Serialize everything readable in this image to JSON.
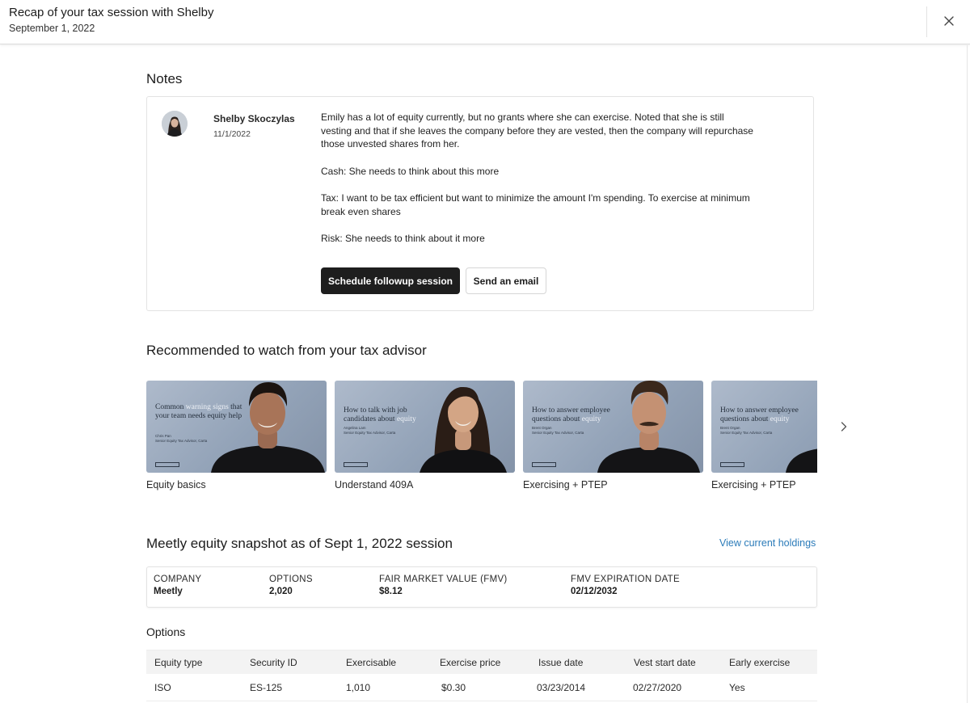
{
  "header": {
    "title": "Recap of your tax session with Shelby",
    "date": "September 1, 2022"
  },
  "notes": {
    "heading": "Notes",
    "author": "Shelby Skoczylas",
    "date": "11/1/2022",
    "paragraphs": [
      "Emily has a lot of equity currently, but no grants where she can exercise. Noted that she is still vesting and that if she leaves the company before they are vested, then the company will repurchase those unvested shares from her.",
      "Cash: She needs to think about this more",
      "Tax: I want to be tax efficient but want to minimize the amount I'm spending. To exercise at minimum break even shares",
      "Risk: She needs to think about it more"
    ],
    "primary_button": "Schedule followup session",
    "secondary_button": "Send an email"
  },
  "recommended": {
    "heading": "Recommended to watch from your tax advisor",
    "videos": [
      {
        "label": "Equity basics",
        "thumb_title_a": "Common",
        "thumb_title_hl": "warning signs",
        "thumb_title_b": "that your team needs equity help",
        "thumb_byline": "Chris Pan\nSenior Equity Tax Advisor, Carta"
      },
      {
        "label": "Understand 409A",
        "thumb_title_a": "How to talk with job candidates about",
        "thumb_title_hl": "equity",
        "thumb_title_b": "",
        "thumb_byline": "Angelina Lam\nSenior Equity Tax Advisor, Carta"
      },
      {
        "label": "Exercising + PTEP",
        "thumb_title_a": "How to answer employee questions about",
        "thumb_title_hl": "equity",
        "thumb_title_b": "",
        "thumb_byline": "Brent Organ\nSenior Equity Tax Advisor, Carta"
      },
      {
        "label": "Exercising + PTEP",
        "thumb_title_a": "How to answer employee questions about",
        "thumb_title_hl": "equity",
        "thumb_title_b": "",
        "thumb_byline": "Brent Organ\nSenior Equity Tax Advisor, Carta"
      }
    ]
  },
  "snapshot": {
    "heading": "Meetly equity snapshot as of Sept 1, 2022 session",
    "link": "View current holdings",
    "company_label": "COMPANY",
    "company_value": "Meetly",
    "options_label": "OPTIONS",
    "options_value": "2,020",
    "fmv_label": "FAIR MARKET VALUE (FMV)",
    "fmv_value": "$8.12",
    "expiration_label": "FMV EXPIRATION DATE",
    "expiration_value": "02/12/2032"
  },
  "options": {
    "heading": "Options",
    "columns": [
      "Equity type",
      "Security ID",
      "Exercisable",
      "Exercise price",
      "Issue date",
      "Vest start date",
      "Early exercise"
    ],
    "rows": [
      [
        "ISO",
        "ES-125",
        "1,010",
        "$0.30",
        "03/23/2014",
        "02/27/2020",
        "Yes"
      ]
    ]
  },
  "colors": {
    "primary_button_bg": "#1e1e1e",
    "link": "#2b7bb9",
    "table_header_bg": "#f3f3f3",
    "thumbnail_bg": "#9dabbf"
  },
  "icons": {
    "close": "close-icon",
    "carousel_next": "chevron-right-icon"
  }
}
